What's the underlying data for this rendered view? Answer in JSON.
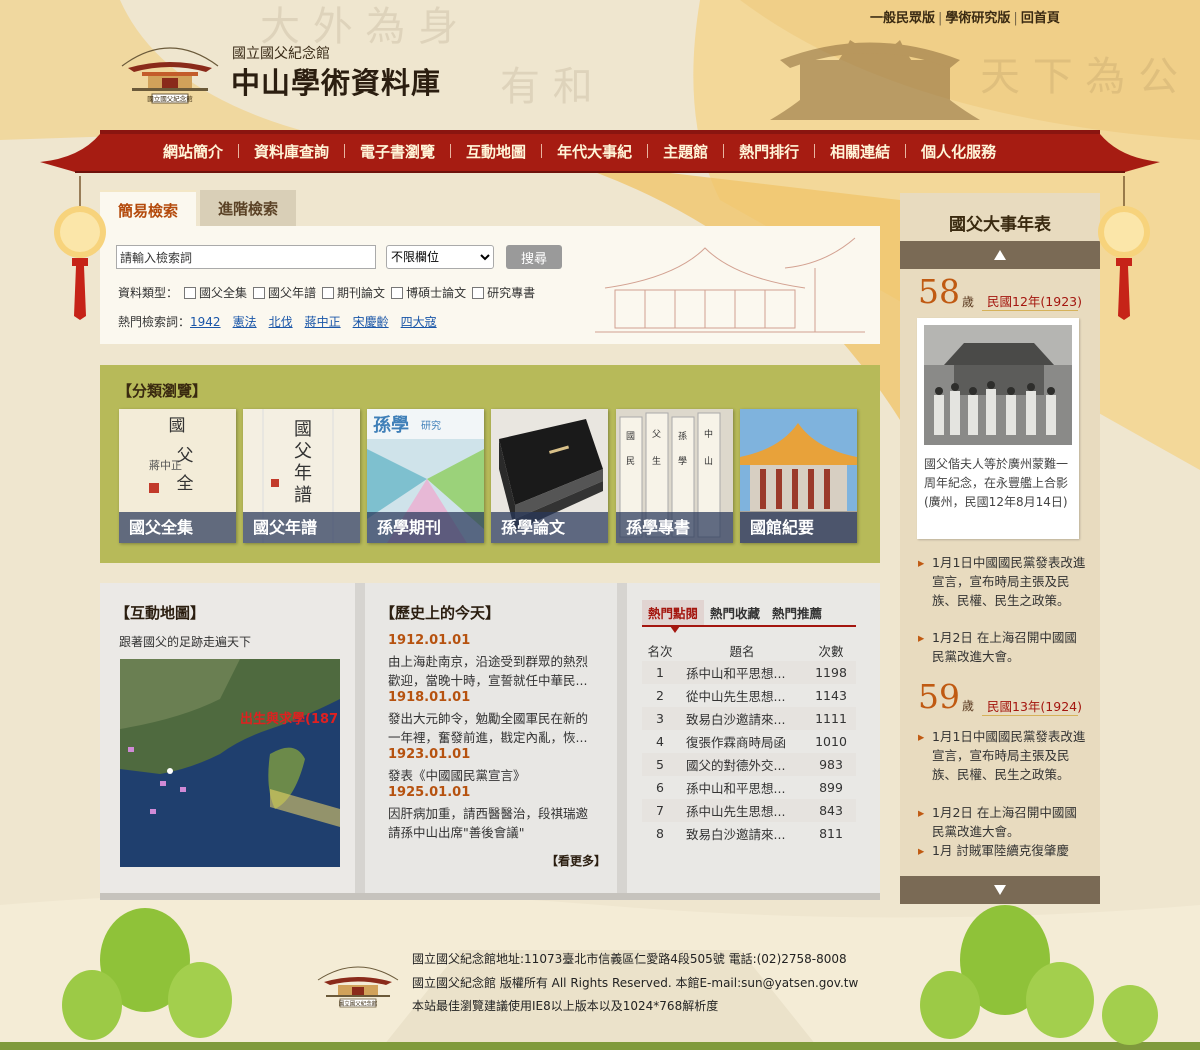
{
  "top_links": [
    "一般民眾版",
    "學術研究版",
    "回首頁"
  ],
  "site": {
    "subtitle": "國立國父紀念館",
    "title": "中山學術資料庫"
  },
  "nav": [
    "網站簡介",
    "資料庫查詢",
    "電子書瀏覽",
    "互動地圖",
    "年代大事紀",
    "主題館",
    "熱門排行",
    "相關連結",
    "個人化服務"
  ],
  "search": {
    "tabs": [
      "簡易檢索",
      "進階檢索"
    ],
    "input_value": "請輸入檢索詞",
    "field_selected": "不限欄位",
    "button": "搜尋",
    "type_label": "資料類型：",
    "types": [
      "國父全集",
      "國父年譜",
      "期刊論文",
      "博碩士論文",
      "研究專書"
    ],
    "hot_label": "熱門檢索詞：",
    "hot_words": [
      "1942",
      "憲法",
      "北伐",
      "蔣中正",
      "宋慶齡",
      "四大寇"
    ]
  },
  "category": {
    "title": "【分類瀏覽】",
    "items": [
      "國父全集",
      "國父年譜",
      "孫學期刊",
      "孫學論文",
      "孫學專書",
      "國館紀要"
    ]
  },
  "map": {
    "title": "【互動地圖】",
    "subtitle": "跟著國父的足跡走遍天下",
    "overlay_text": "出生與求學(187"
  },
  "history": {
    "title": "【歷史上的今天】",
    "entries": [
      {
        "date": "1912.01.01",
        "line1": "由上海赴南京，沿途受到群眾的熱烈",
        "line2": "歡迎，當晚十時，宣誓就任中華民..."
      },
      {
        "date": "1918.01.01",
        "line1": "發出大元帥令，勉勵全國軍民在新的",
        "line2": "一年裡，奮發前進，戡定內亂，恢..."
      },
      {
        "date": "1923.01.01",
        "line1": "發表《中國國民黨宣言》",
        "line2": ""
      },
      {
        "date": "1925.01.01",
        "line1": "因肝病加重，請西醫醫治，段祺瑞邀",
        "line2": "請孫中山出席\"善後會議\""
      }
    ],
    "more": "【看更多】"
  },
  "ranking": {
    "tabs": [
      "熱門點閱",
      "熱門收藏",
      "熱門推薦"
    ],
    "headers": [
      "名次",
      "題名",
      "次數"
    ],
    "rows": [
      {
        "rank": "1",
        "title": "孫中山和平思想...",
        "count": "1198"
      },
      {
        "rank": "2",
        "title": "從中山先生思想...",
        "count": "1143"
      },
      {
        "rank": "3",
        "title": "致易白沙邀請來...",
        "count": "1111"
      },
      {
        "rank": "4",
        "title": "復張作霖商時局函",
        "count": "1010"
      },
      {
        "rank": "5",
        "title": "國父的對德外交...",
        "count": "983"
      },
      {
        "rank": "6",
        "title": "孫中山和平思想...",
        "count": "899"
      },
      {
        "rank": "7",
        "title": "孫中山先生思想...",
        "count": "843"
      },
      {
        "rank": "8",
        "title": "致易白沙邀請來...",
        "count": "811"
      }
    ]
  },
  "timeline": {
    "title": "國父大事年表",
    "sui": "歲",
    "year1": {
      "age": "58",
      "year": "民國12年(1923)"
    },
    "photo_caption": "國父偕夫人等於廣州蒙難一周年紀念，在永豐艦上合影(廣州，民國12年8月14日)",
    "events1": [
      "1月1日中國國民黨發表改進宣言，宣布時局主張及民族、民權、民生之政策。",
      "1月2日 在上海召開中國國民黨改進大會。"
    ],
    "year2": {
      "age": "59",
      "year": "民國13年(1924)"
    },
    "events2": [
      "1月1日中國國民黨發表改進宣言，宣布時局主張及民族、民權、民生之政策。",
      "1月2日 在上海召開中國國民黨改進大會。",
      "1月 討賊軍陸續克復肇慶"
    ]
  },
  "footer": {
    "line1": "國立國父紀念館地址:11073臺北市信義區仁愛路4段505號 電話:(02)2758-8008",
    "line2": "國立國父紀念館 版權所有 All Rights Reserved. 本館E-mail:sun@yatsen.gov.tw",
    "line3": "本站最佳瀏覽建議使用IE8以上版本以及1024*768解析度"
  }
}
